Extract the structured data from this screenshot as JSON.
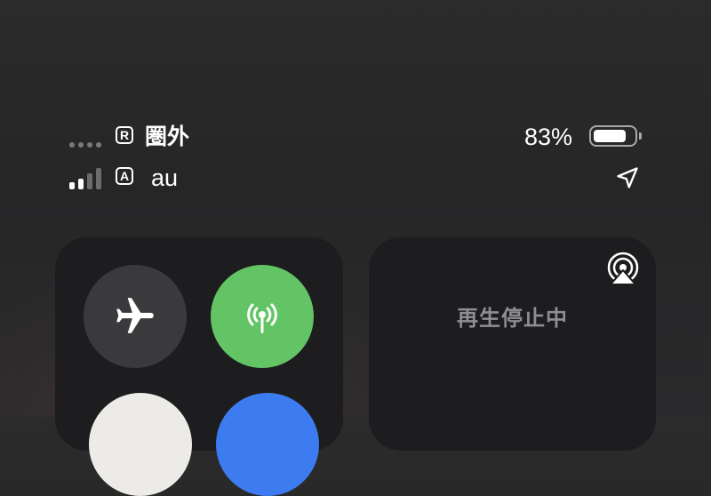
{
  "status_bar": {
    "sim1": {
      "badge": "R",
      "carrier": "圏外",
      "signal_bars": 0
    },
    "sim2": {
      "badge": "A",
      "carrier": "au",
      "signal_bars": 2
    },
    "battery": {
      "percent_label": "83%",
      "level": 0.83
    },
    "location_services": "location-arrow-icon"
  },
  "control_center": {
    "connectivity": {
      "airplane_mode": {
        "icon": "airplane-icon",
        "on": false,
        "color": "#3a3a3c"
      },
      "cellular_data": {
        "icon": "cellular-antenna-icon",
        "on": true,
        "color": "#63c465"
      },
      "wifi": {
        "on": true,
        "color": "#ecebe7"
      },
      "bluetooth": {
        "on": true,
        "color": "#3d7cf0"
      }
    },
    "media": {
      "status": "再生停止中",
      "airplay_icon": "airplay-audio-icon"
    }
  }
}
